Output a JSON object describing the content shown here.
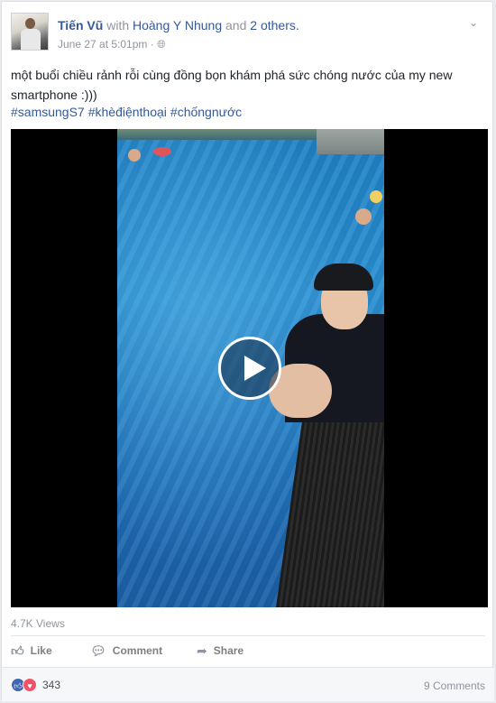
{
  "post": {
    "author": "Tiến Vũ",
    "with_text": "with",
    "tagged": "Hoàng Y Nhung",
    "and_text": "and",
    "others": "2 others.",
    "timestamp": "June 27 at 5:01pm ·",
    "privacy_icon": "globe-icon",
    "menu_icon": "chevron-down-icon",
    "text": "một buổi chiều rảnh rỗi cùng đồng bọn khám phá sức chóng nước của my new smartphone :)))",
    "hashtags": [
      "#samsungS7",
      "#khèđiệnthoại",
      "#chốngnước"
    ]
  },
  "video": {
    "play_icon": "play-icon",
    "views": "4.7K Views"
  },
  "actions": {
    "like": "Like",
    "comment": "Comment",
    "share": "Share"
  },
  "footer": {
    "reaction_icons": [
      "like-reaction-icon",
      "love-reaction-icon"
    ],
    "reactions_count": "343",
    "comments_count": "9 Comments"
  },
  "colors": {
    "link": "#365899",
    "muted": "#90949c",
    "like_blue": "#4267b2",
    "love_red": "#f25268"
  }
}
